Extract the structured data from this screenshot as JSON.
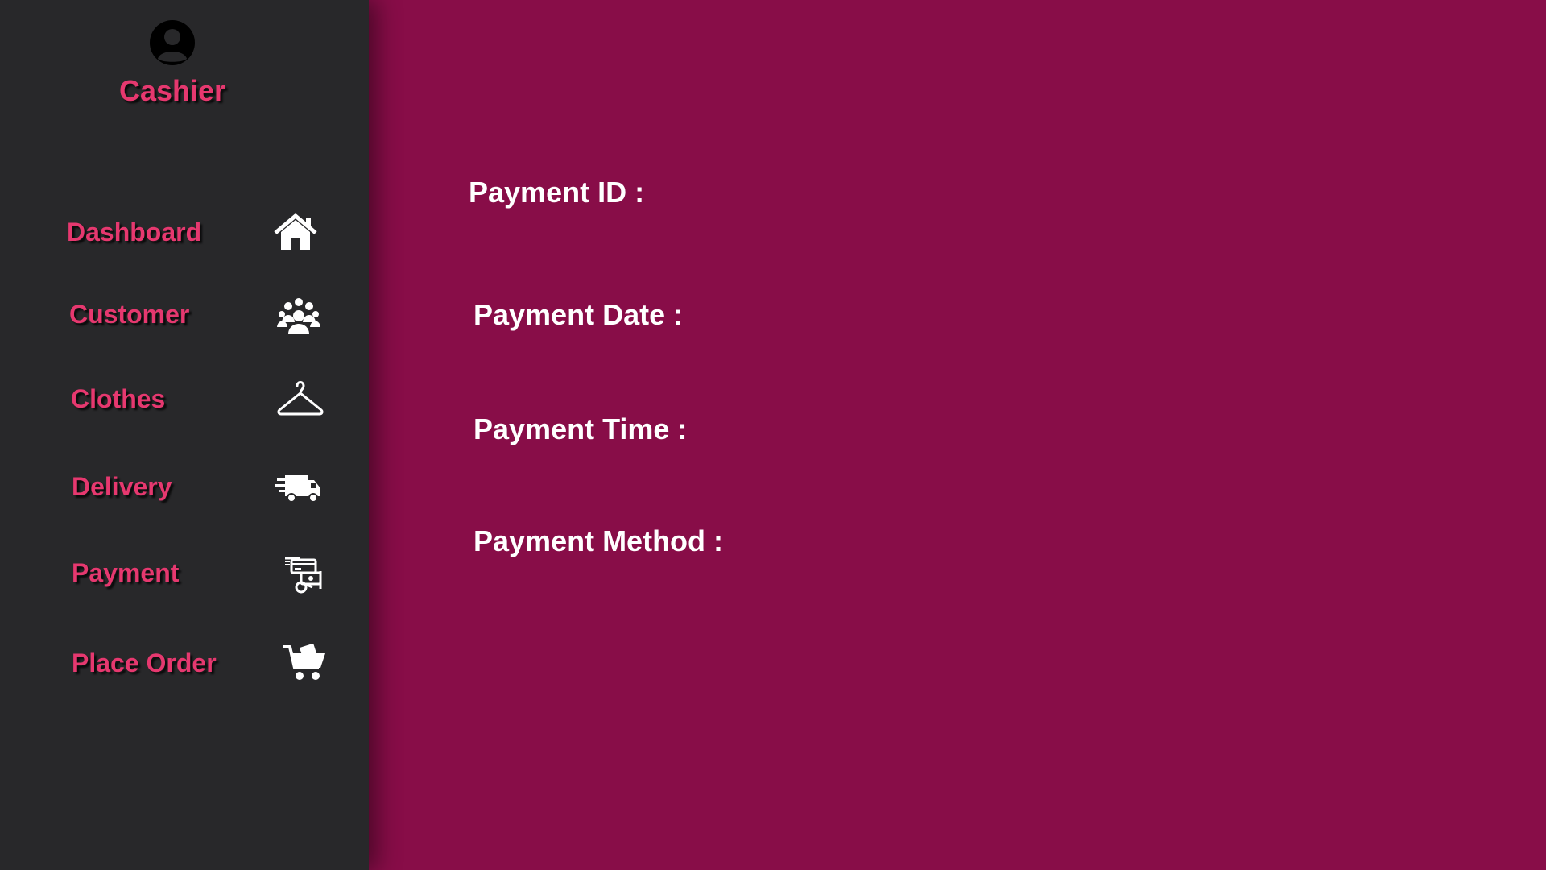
{
  "sidebar": {
    "role_title": "Cashier",
    "items": [
      {
        "label": "Dashboard",
        "icon": "home-icon"
      },
      {
        "label": "Customer",
        "icon": "users-icon"
      },
      {
        "label": "Clothes",
        "icon": "hanger-icon"
      },
      {
        "label": "Delivery",
        "icon": "truck-icon"
      },
      {
        "label": "Payment",
        "icon": "payment-icon"
      },
      {
        "label": "Place Order",
        "icon": "cart-icon"
      }
    ]
  },
  "main": {
    "fields": [
      {
        "label": "Payment ID :"
      },
      {
        "label": "Payment Date :"
      },
      {
        "label": "Payment Time :"
      },
      {
        "label": "Payment Method :"
      }
    ]
  },
  "colors": {
    "sidebar_bg": "#28282a",
    "main_bg": "#880d48",
    "accent": "#e6386f",
    "label_text": "#ffffff"
  }
}
